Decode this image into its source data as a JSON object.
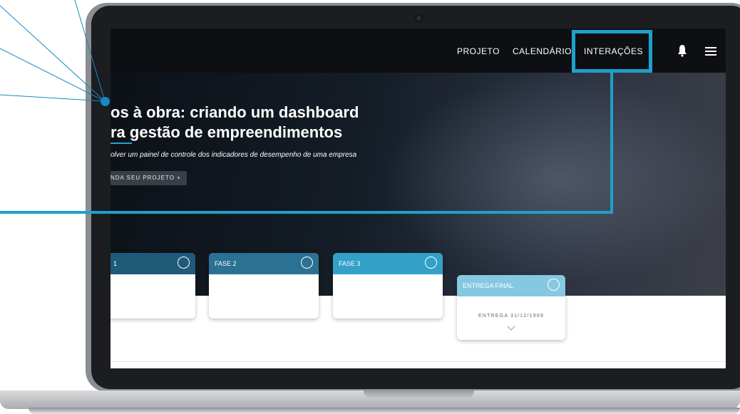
{
  "nav": {
    "items": [
      "PROJETO",
      "CALENDÁRIO",
      "INTERAÇÕES"
    ],
    "bell_icon": "bell-icon",
    "menu_icon": "hamburger-menu-icon"
  },
  "hero": {
    "title_line1": "os à obra: criando um dashboard",
    "title_line2": "ra gestão de empreendimentos",
    "subtitle": "olver um painel de controle dos indicadores de desempenho de uma empresa",
    "button": "NDA SEU PROJETO +"
  },
  "cards": [
    {
      "label": "1",
      "color": "#1f5a79"
    },
    {
      "label": "FASE 2",
      "color": "#2a7193"
    },
    {
      "label": "FASE 3",
      "color": "#33a0c8"
    }
  ],
  "final_card": {
    "label": "ENTREGA FINAL",
    "color": "#86c8e0",
    "delivery": "ENTREGA 31/12/1969"
  },
  "colors": {
    "accent": "#1ea0cc",
    "callout_dot": "#1689c1"
  }
}
